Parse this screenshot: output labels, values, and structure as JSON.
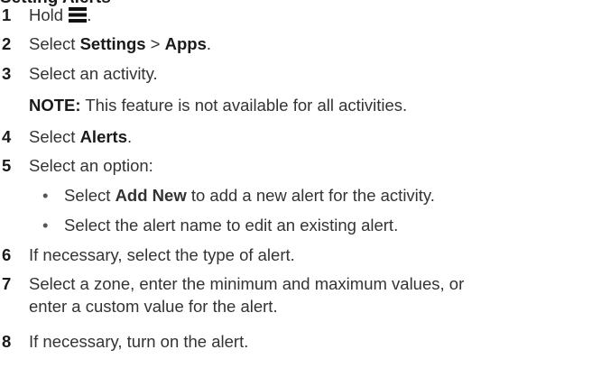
{
  "heading": "Setting Alerts",
  "steps": [
    {
      "num": "1",
      "pre": "Hold ",
      "icon": "menu-icon",
      "post": "."
    },
    {
      "num": "2",
      "pre": "Select ",
      "b1": "Settings",
      "mid": " > ",
      "b2": "Apps",
      "post": "."
    },
    {
      "num": "3",
      "text": "Select an activity."
    },
    {
      "note_label": "NOTE:",
      "note_text": " This feature is not available for all activities."
    },
    {
      "num": "4",
      "pre": "Select ",
      "b1": "Alerts",
      "post": "."
    },
    {
      "num": "5",
      "text": "Select an option:"
    },
    {
      "bullet": "•",
      "pre": "Select ",
      "b1": "Add New",
      "post": " to add a new alert for the activity."
    },
    {
      "bullet": "•",
      "text": "Select the alert name to edit an existing alert."
    },
    {
      "num": "6",
      "text": "If necessary, select the type of alert."
    },
    {
      "num": "7",
      "text": "Select a zone, enter the minimum and maximum values, or",
      "text2": "enter a custom value for the alert."
    },
    {
      "num": "8",
      "text": "If necessary, turn on the alert."
    }
  ]
}
